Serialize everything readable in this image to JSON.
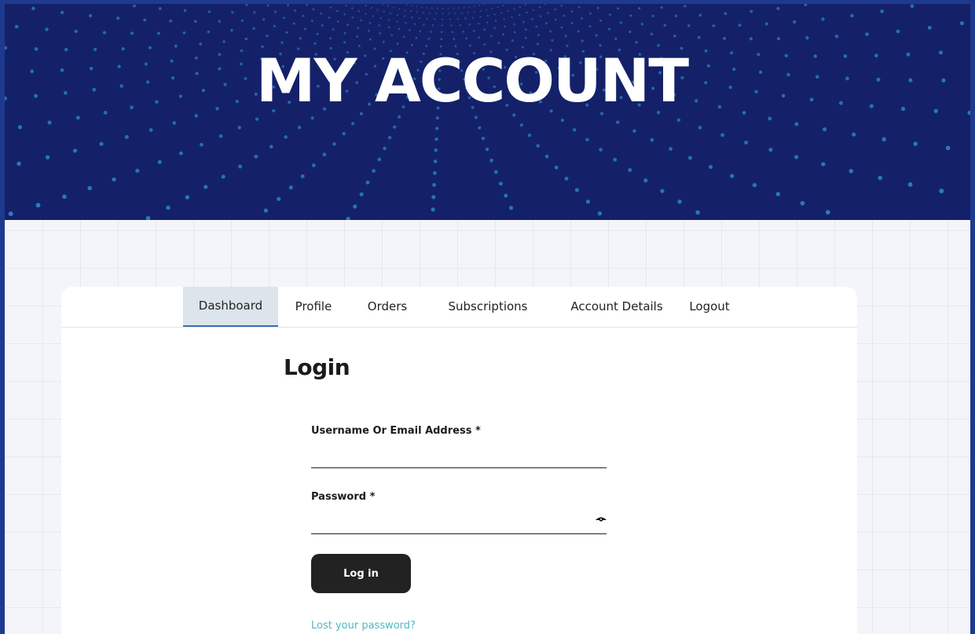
{
  "hero": {
    "title": "MY ACCOUNT",
    "background_color": "#142169",
    "dot_color": "#2a8fd0"
  },
  "nav": {
    "tabs": [
      {
        "label": "Dashboard",
        "active": true
      },
      {
        "label": "Profile",
        "active": false
      },
      {
        "label": "Orders",
        "active": false
      },
      {
        "label": "Subscriptions",
        "active": false
      },
      {
        "label": "Account Details",
        "active": false
      },
      {
        "label": "Logout",
        "active": false
      }
    ]
  },
  "login": {
    "heading": "Login",
    "username_label": "Username Or Email Address *",
    "username_value": "",
    "password_label": "Password *",
    "password_value": "",
    "show_password_icon": "eye-icon",
    "submit_label": "Log in",
    "lost_password_link": "Lost your password?",
    "link_color": "#4fb8c4",
    "button_color": "#222222"
  }
}
